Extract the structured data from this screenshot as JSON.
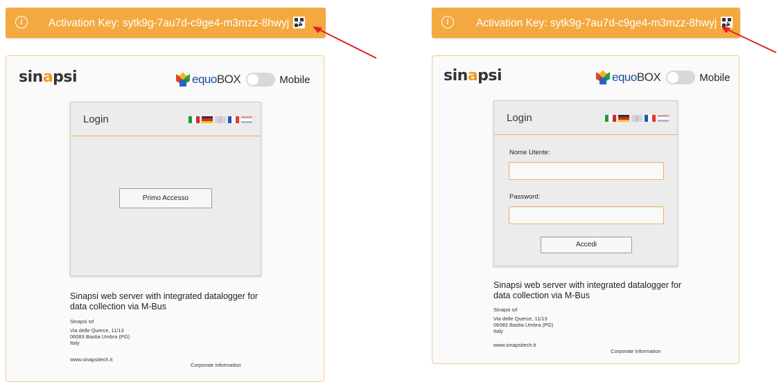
{
  "left": {
    "banner": {
      "info_glyph": "i",
      "activation_text": "Activation Key: sytk9g-7au7d-c9ge4-m3mzz-8hwyj"
    },
    "logo": {
      "prefix": "sin",
      "accent": "a",
      "suffix": "psi"
    },
    "equobox": {
      "brand_main": "equo",
      "brand_tail": "BOX"
    },
    "mobile_label": "Mobile",
    "login": {
      "title": "Login",
      "first_access_button": "Primo Accesso"
    },
    "description": "Sinapsi web server with integrated datalogger for data collection via M-Bus",
    "company": {
      "name": "Sinapsi srl",
      "street": "Via delle Querce, 11/13",
      "city": "06083 Bastia Umbra (PG)",
      "country": "Italy"
    },
    "website": "www.sinapsitech.it",
    "corporate_link": "Corporate information"
  },
  "right": {
    "banner": {
      "info_glyph": "i",
      "activation_text": "Activation Key: sytk9g-7au7d-c9ge4-m3mzz-8hwyj"
    },
    "logo": {
      "prefix": "sin",
      "accent": "a",
      "suffix": "psi"
    },
    "equobox": {
      "brand_main": "equo",
      "brand_tail": "BOX"
    },
    "mobile_label": "Mobile",
    "login": {
      "title": "Login",
      "username_label": "Nome Utente:",
      "username_value": "",
      "password_label": "Password:",
      "password_value": "",
      "submit_button": "Accedi"
    },
    "description": "Sinapsi web server with integrated datalogger for data collection via M-Bus",
    "company": {
      "name": "Sinapsi srl",
      "street": "Via delle Querce, 11/13",
      "city": "06083 Bastia Umbra (PG)",
      "country": "Italy"
    },
    "website": "www.sinapsitech.it",
    "corporate_link": "Corporate information"
  },
  "colors": {
    "banner": "#f4a940",
    "accent": "#f0b45a",
    "arrow": "#e02020"
  },
  "flags": [
    "italy",
    "germany",
    "uk",
    "france",
    "netherlands"
  ]
}
